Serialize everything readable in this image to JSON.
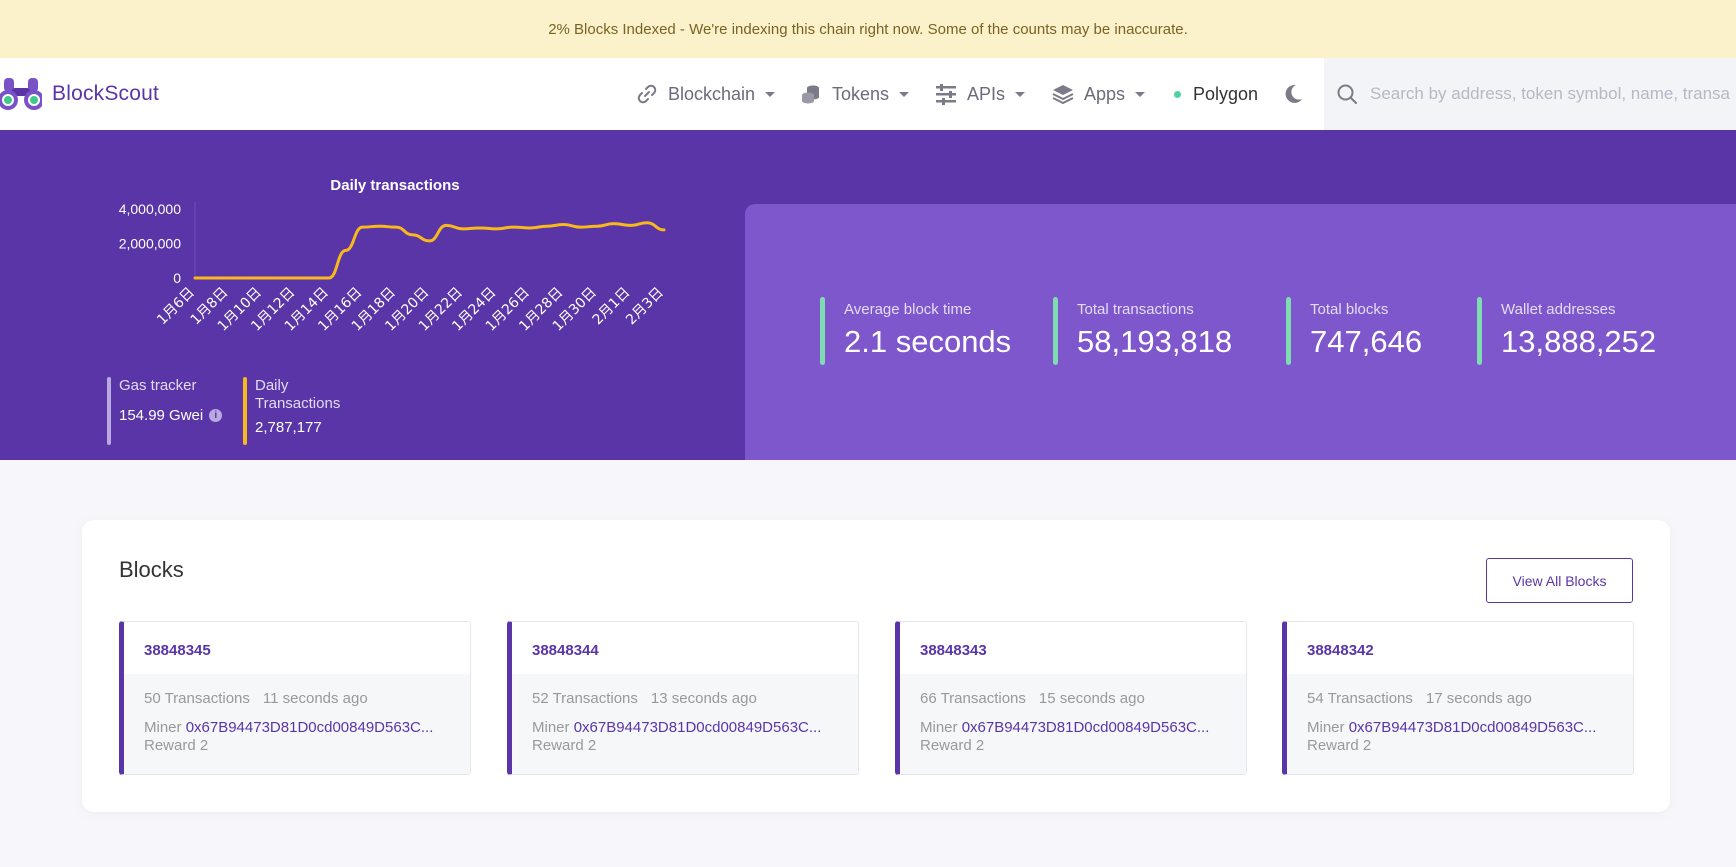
{
  "banner": {
    "text": "2% Blocks Indexed - We're indexing this chain right now. Some of the counts may be inaccurate."
  },
  "brand": {
    "name": "BlockScout"
  },
  "nav": {
    "blockchain": "Blockchain",
    "tokens": "Tokens",
    "apis": "APIs",
    "apps": "Apps",
    "network": "Polygon",
    "network_status_color": "#4ed39e"
  },
  "search": {
    "placeholder": "Search by address, token symbol, name, transaction hash, or block number"
  },
  "chart_data": {
    "type": "line",
    "title": "Daily transactions",
    "x": [
      "1月6日",
      "1月7日",
      "1月8日",
      "1月9日",
      "1月10日",
      "1月11日",
      "1月12日",
      "1月13日",
      "1月14日",
      "1月15日",
      "1月16日",
      "1月17日",
      "1月18日",
      "1月19日",
      "1月20日",
      "1月21日",
      "1月22日",
      "1月23日",
      "1月24日",
      "1月25日",
      "1月26日",
      "1月27日",
      "1月28日",
      "1月29日",
      "1月30日",
      "1月31日",
      "2月1日",
      "2月2日",
      "2月3日"
    ],
    "x_tick_labels": [
      "1月6日",
      "1月8日",
      "1月10日",
      "1月12日",
      "1月14日",
      "1月16日",
      "1月18日",
      "1月20日",
      "1月22日",
      "1月24日",
      "1月26日",
      "1月28日",
      "1月30日",
      "2月1日",
      "2月3日"
    ],
    "series": [
      {
        "values": [
          0,
          0,
          0,
          0,
          0,
          0,
          0,
          0,
          0,
          1600000,
          2950000,
          3000000,
          2950000,
          2500000,
          2150000,
          3050000,
          2850000,
          2900000,
          2850000,
          2950000,
          2900000,
          3000000,
          3100000,
          2950000,
          3000000,
          3150000,
          3050000,
          3200000,
          2787177
        ],
        "color": "#f9b81b"
      }
    ],
    "y_ticks": [
      "4,000,000",
      "2,000,000",
      "0"
    ],
    "ylim": [
      0,
      4000000
    ],
    "grid": false
  },
  "mini_stats": {
    "gas": {
      "label": "Gas tracker",
      "value": "154.99 Gwei",
      "info_icon": "i"
    },
    "daily": {
      "label1": "Daily",
      "label2": "Transactions",
      "value": "2,787,177"
    }
  },
  "stats": {
    "avg_block": {
      "label": "Average block time",
      "value": "2.1 seconds"
    },
    "total_tx": {
      "label": "Total transactions",
      "value": "58,193,818"
    },
    "total_blocks": {
      "label": "Total blocks",
      "value": "747,646"
    },
    "wallets": {
      "label": "Wallet addresses",
      "value": "13,888,252"
    }
  },
  "blocks": {
    "title": "Blocks",
    "view_all_label": "View All Blocks",
    "items": [
      {
        "number": "38848345",
        "transactions": "50 Transactions",
        "age": "11 seconds ago",
        "miner_label": "Miner",
        "miner": "0x67B94473D81D0cd00849D563C...",
        "reward": "Reward 2"
      },
      {
        "number": "38848344",
        "transactions": "52 Transactions",
        "age": "13 seconds ago",
        "miner_label": "Miner",
        "miner": "0x67B94473D81D0cd00849D563C...",
        "reward": "Reward 2"
      },
      {
        "number": "38848343",
        "transactions": "66 Transactions",
        "age": "15 seconds ago",
        "miner_label": "Miner",
        "miner": "0x67B94473D81D0cd00849D563C...",
        "reward": "Reward 2"
      },
      {
        "number": "38848342",
        "transactions": "54 Transactions",
        "age": "17 seconds ago",
        "miner_label": "Miner",
        "miner": "0x67B94473D81D0cd00849D563C...",
        "reward": "Reward 2"
      }
    ]
  },
  "colors": {
    "brand_purple": "#5a35a8",
    "stats_panel": "#7f57cc",
    "stat_accent": "#7fdcb0",
    "chart_line": "#f9b81b",
    "banner_bg": "#fbf2cc"
  }
}
